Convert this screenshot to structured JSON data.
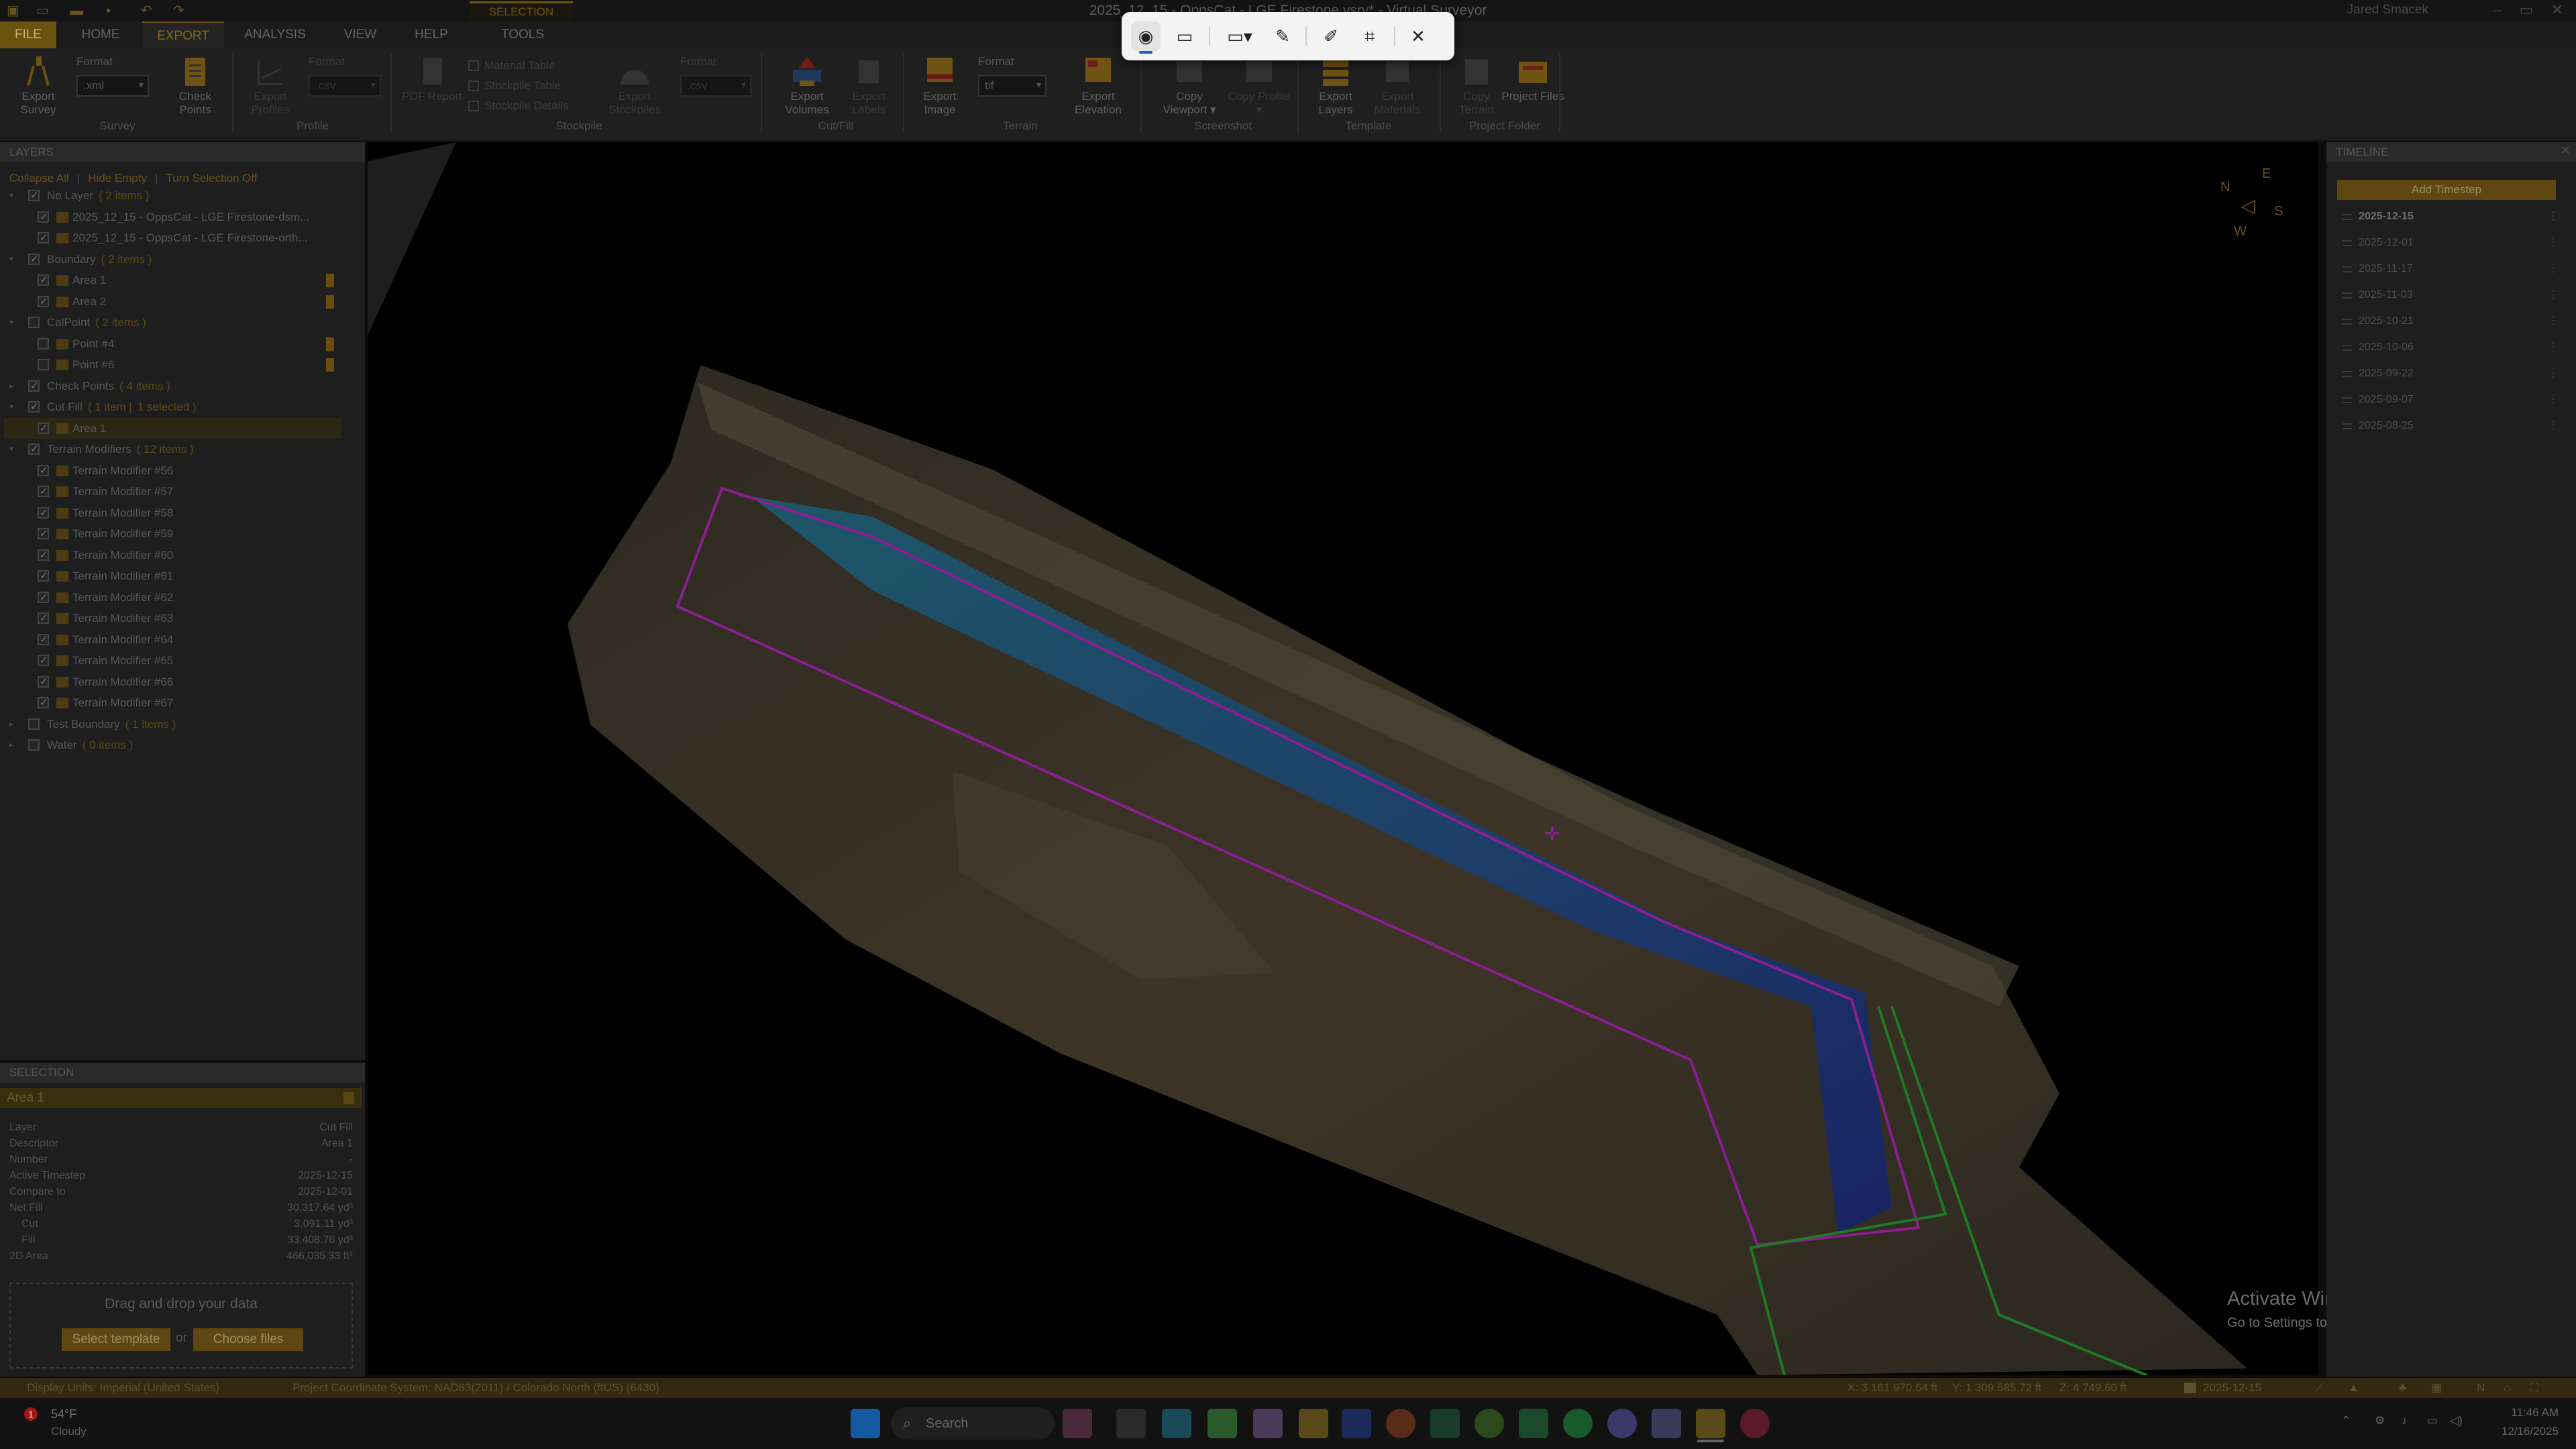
{
  "window": {
    "title": "2025_12_15 - OppsCat - LGE Firestone.vsrv* - Virtual Surveyor",
    "user": "Jared Smacek",
    "context_tab": "SELECTION"
  },
  "tabs": [
    "FILE",
    "HOME",
    "EXPORT",
    "ANALYSIS",
    "VIEW",
    "HELP",
    "TOOLS"
  ],
  "ribbon": {
    "survey": {
      "btn": "Export Survey",
      "format_label": "Format",
      "format": ".xml",
      "group": "Survey"
    },
    "checkpoints": {
      "btn": "Check Points"
    },
    "profile": {
      "btn": "Export Profiles",
      "format_label": "Format",
      "format": ".csv",
      "group": "Profile"
    },
    "stockpile": {
      "pdf": "PDF Report",
      "cb1": "Material Table",
      "cb2": "Stockpile Table",
      "cb3": "Stockpile Details",
      "btn": "Export Stockpiles",
      "format_label": "Format",
      "format": ".csv",
      "group": "Stockpile"
    },
    "cutfill": {
      "vol": "Export Volumes",
      "labels": "Export Labels",
      "group": "Cut/Fill"
    },
    "terrain": {
      "img": "Export Image",
      "format_label": "Format",
      "format": "tif",
      "elev": "Export Elevation",
      "group": "Terrain"
    },
    "screenshot": {
      "copy": "Copy Viewport",
      "profile": "Copy Profile",
      "group": "Screenshot"
    },
    "template": {
      "layers": "Export Layers",
      "materials": "Export Materials",
      "group": "Template"
    },
    "project": {
      "terrain": "Copy Terrain",
      "files": "Project Files",
      "group": "Project Folder"
    }
  },
  "layers_panel": {
    "title": "LAYERS",
    "links": [
      "Collapse All",
      "Hide Empty",
      "Turn Selection Off"
    ],
    "rows": [
      {
        "t": "g",
        "name": "No Layer",
        "count": "( 2 items )",
        "ck": true,
        "open": true
      },
      {
        "t": "i",
        "name": "2025_12_15 - OppsCat - LGE Firestone-dsm...",
        "ck": true
      },
      {
        "t": "i",
        "name": "2025_12_15 - OppsCat - LGE Firestone-orth...",
        "ck": true
      },
      {
        "t": "g",
        "name": "Boundary",
        "count": "( 2 items )",
        "ck": true,
        "open": true
      },
      {
        "t": "i",
        "name": "Area 1",
        "ck": true,
        "pin": true
      },
      {
        "t": "i",
        "name": "Area 2",
        "ck": true,
        "pin": true
      },
      {
        "t": "g",
        "name": "CalPoint",
        "count": "( 2 items )",
        "ck": false,
        "open": true
      },
      {
        "t": "i",
        "name": "Point #4",
        "ck": false,
        "pin": true
      },
      {
        "t": "i",
        "name": "Point #6",
        "ck": false,
        "pin": true
      },
      {
        "t": "g",
        "name": "Check Points",
        "count": "( 4 items )",
        "ck": true,
        "open": false
      },
      {
        "t": "g",
        "name": "Cut Fill",
        "count": "( 1 item |",
        "count2": "1 selected )",
        "ck": true,
        "open": true
      },
      {
        "t": "i",
        "name": "Area 1",
        "ck": true,
        "sel": true
      },
      {
        "t": "g",
        "name": "Terrain Modifiers",
        "count": "( 12 items )",
        "ck": true,
        "open": true
      },
      {
        "t": "i",
        "name": "Terrain Modifier #56",
        "ck": true
      },
      {
        "t": "i",
        "name": "Terrain Modifier #57",
        "ck": true
      },
      {
        "t": "i",
        "name": "Terrain Modifier #58",
        "ck": true
      },
      {
        "t": "i",
        "name": "Terrain Modifier #59",
        "ck": true
      },
      {
        "t": "i",
        "name": "Terrain Modifier #60",
        "ck": true
      },
      {
        "t": "i",
        "name": "Terrain Modifier #61",
        "ck": true
      },
      {
        "t": "i",
        "name": "Terrain Modifier #62",
        "ck": true
      },
      {
        "t": "i",
        "name": "Terrain Modifier #63",
        "ck": true
      },
      {
        "t": "i",
        "name": "Terrain Modifier #64",
        "ck": true
      },
      {
        "t": "i",
        "name": "Terrain Modifier #65",
        "ck": true
      },
      {
        "t": "i",
        "name": "Terrain Modifier #66",
        "ck": true
      },
      {
        "t": "i",
        "name": "Terrain Modifier #67",
        "ck": true
      },
      {
        "t": "g",
        "name": "Test Boundary",
        "count": "( 1 items )",
        "ck": false,
        "open": false
      },
      {
        "t": "g",
        "name": "Water",
        "count": "( 0 items )",
        "ck": false,
        "open": false
      }
    ]
  },
  "selection_panel": {
    "title": "SELECTION",
    "name": "Area 1",
    "props": [
      [
        "Layer",
        "Cut Fill"
      ],
      [
        "Descriptor",
        "Area 1"
      ],
      [
        "Number",
        "-"
      ],
      [
        "Active Timestep",
        "2025-12-15"
      ],
      [
        "Compare to",
        "2025-12-01"
      ],
      [
        "Net Fill",
        "30,317.64 yd³"
      ],
      [
        "Cut",
        "3,091.11 yd³"
      ],
      [
        "Fill",
        "33,408.76 yd³"
      ],
      [
        "2D Area",
        "466,035.33 ft²"
      ]
    ],
    "drop_text": "Drag and drop your data",
    "select_template": "Select template",
    "or": "or",
    "choose_files": "Choose files"
  },
  "compass": {
    "n": "N",
    "e": "E",
    "s": "S",
    "w": "W"
  },
  "activate": {
    "title": "Activate Windows",
    "sub": "Go to Settings to activate Windows."
  },
  "timeline": {
    "title": "TIMELINE",
    "add": "Add Timestep",
    "dates": [
      "2025-12-15",
      "2025-12-01",
      "2025-11-17",
      "2025-11-03",
      "2025-10-21",
      "2025-10-06",
      "2025-09-22",
      "2025-09-07",
      "2025-08-25"
    ],
    "more": "⋮"
  },
  "status": {
    "units": "Display Units:  Imperial (United States)",
    "crs": "Project Coordinate System:  NAD83(2011) / Colorado North (ftUS) (6430)",
    "x": "X: 3 161 970.64 ft",
    "y": "Y: 1 309 585.72 ft",
    "z": "Z: 4 749.60 ft",
    "date": "2025-12-15"
  },
  "taskbar": {
    "temp": "54°F",
    "weather": "Cloudy",
    "badge": "1",
    "search": "Search",
    "time": "11:46 AM",
    "date": "12/16/2025"
  },
  "colors": {
    "accent": "#6a520f",
    "cutfill_boundary": "#9b1fa0",
    "green_boundary": "#1e7a24"
  }
}
